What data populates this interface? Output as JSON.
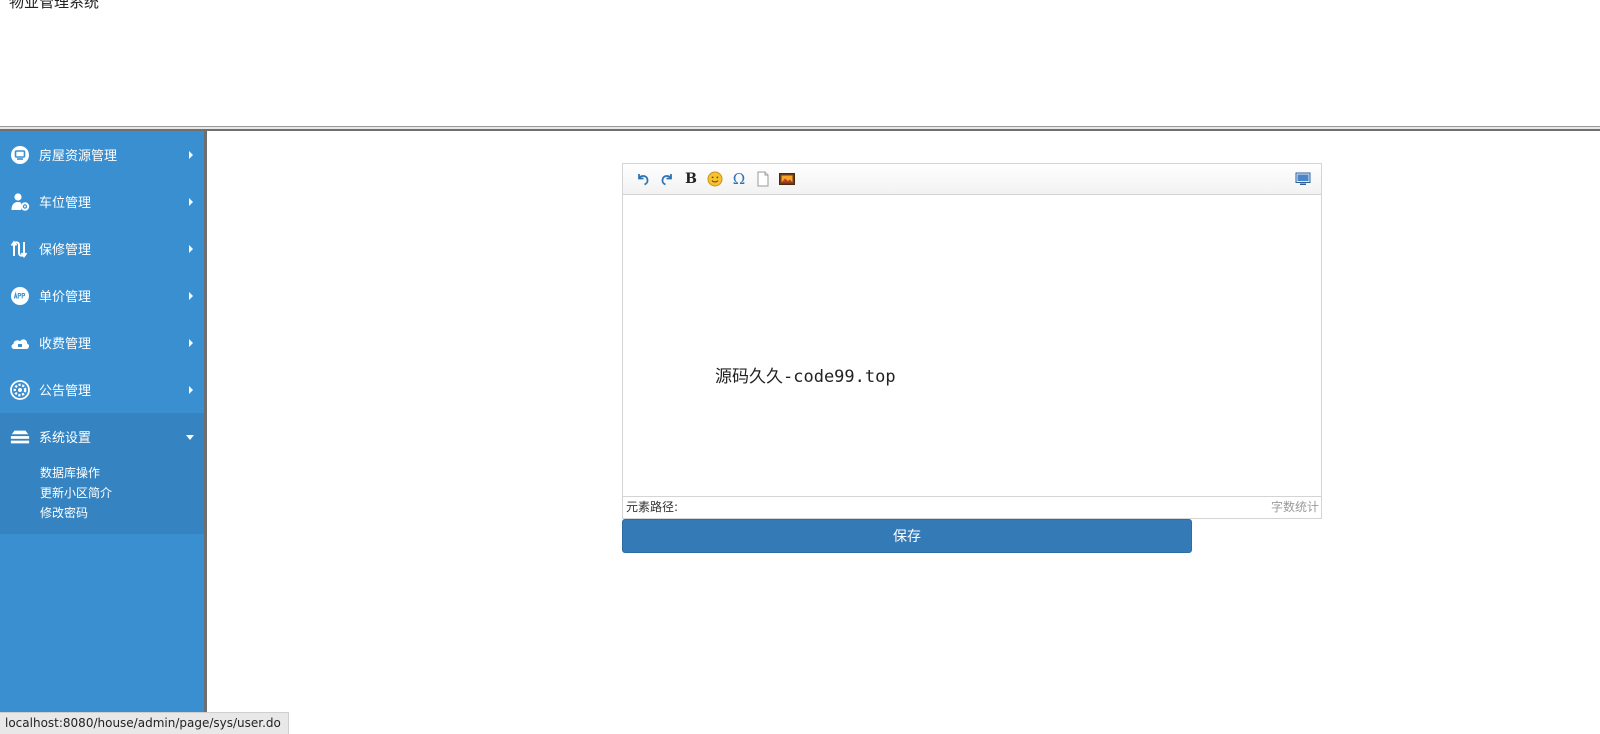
{
  "header": {
    "title": "物业管理系统"
  },
  "sidebar": {
    "items": [
      {
        "label": "房屋资源管理",
        "icon": "monitor-circle-icon"
      },
      {
        "label": "车位管理",
        "icon": "user-gear-icon"
      },
      {
        "label": "保修管理",
        "icon": "repair-arrows-icon"
      },
      {
        "label": "单价管理",
        "icon": "app-circle-icon"
      },
      {
        "label": "收费管理",
        "icon": "cloud-icon"
      },
      {
        "label": "公告管理",
        "icon": "gear-circle-icon"
      },
      {
        "label": "系统设置",
        "icon": "layers-icon",
        "expanded": true,
        "children": [
          "数据库操作",
          "更新小区简介",
          "修改密码"
        ]
      }
    ]
  },
  "editor": {
    "toolbar": [
      "undo-icon",
      "redo-icon",
      "bold-icon",
      "emotion-icon",
      "special-char-icon",
      "new-page-icon",
      "image-icon",
      "fullscreen-icon"
    ],
    "bold_label": "B",
    "special_char_label": "Ω",
    "content": "源码久久-code99.top",
    "element_path_label": "元素路径:",
    "word_count_label": "字数统计"
  },
  "actions": {
    "save_label": "保存"
  },
  "browser": {
    "status_url": "localhost:8080/house/admin/page/sys/user.do"
  },
  "colors": {
    "sidebar_bg": "#3a8fd0",
    "sidebar_open_bg": "#3584c1",
    "primary_button": "#337ab7"
  }
}
